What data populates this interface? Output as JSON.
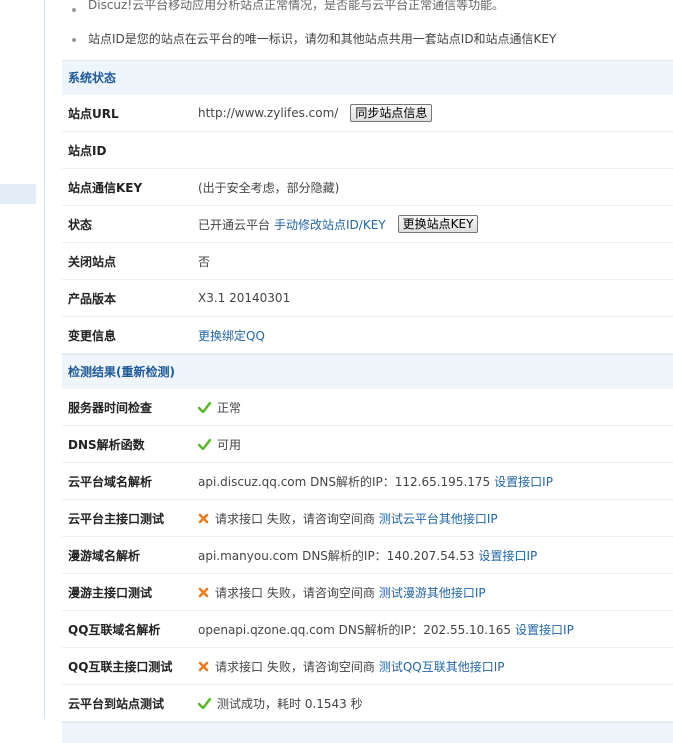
{
  "notices": [
    "Discuz!云平台移动应用分析站点正常情况，是否能与云平台正常通信等功能。",
    "站点ID是您的站点在云平台的唯一标识，请勿和其他站点共用一套站点ID和站点通信KEY"
  ],
  "system_status": {
    "title": "系统状态",
    "rows": [
      {
        "label": "站点URL",
        "value": "http://www.zylifes.com/",
        "button": "同步站点信息"
      },
      {
        "label": "站点ID",
        "value": ""
      },
      {
        "label": "站点通信KEY",
        "value": "(出于安全考虑，部分隐藏)"
      },
      {
        "label": "状态",
        "value": "已开通云平台",
        "link": "手动修改站点ID/KEY",
        "button": "更换站点KEY"
      },
      {
        "label": "关闭站点",
        "value": "否"
      },
      {
        "label": "产品版本",
        "value": "X3.1 20140301"
      },
      {
        "label": "变更信息",
        "link": "更换绑定QQ"
      }
    ]
  },
  "check_results": {
    "title": "检测结果(重新检测)",
    "rows": [
      {
        "label": "服务器时间检查",
        "icon": "check-icon",
        "value": "正常"
      },
      {
        "label": "DNS解析函数",
        "icon": "check-icon",
        "value": "可用"
      },
      {
        "label": "云平台域名解析",
        "value": "api.discuz.qq.com DNS解析的IP：112.65.195.175",
        "link": "设置接口IP"
      },
      {
        "label": "云平台主接口测试",
        "icon": "error-icon",
        "value": "请求接口 失败，请咨询空间商",
        "link": "测试云平台其他接口IP"
      },
      {
        "label": "漫游域名解析",
        "value": "api.manyou.com DNS解析的IP：140.207.54.53",
        "link": "设置接口IP"
      },
      {
        "label": "漫游主接口测试",
        "icon": "error-icon",
        "value": "请求接口 失败，请咨询空间商",
        "link": "测试漫游其他接口IP"
      },
      {
        "label": "QQ互联域名解析",
        "value": "openapi.qzone.qq.com DNS解析的IP：202.55.10.165",
        "link": "设置接口IP"
      },
      {
        "label": "QQ互联主接口测试",
        "icon": "error-icon",
        "value": "请求接口 失败，请咨询空间商",
        "link": "测试QQ互联其他接口IP"
      },
      {
        "label": "云平台到站点测试",
        "icon": "check-icon",
        "value": "测试成功，耗时 0.1543 秒"
      }
    ]
  },
  "colors": {
    "accent": "#1f5a9b",
    "link": "#2366a8",
    "ok": "#5cb82e",
    "error": "#f07a1c",
    "section_bg": "#eef5fb"
  }
}
